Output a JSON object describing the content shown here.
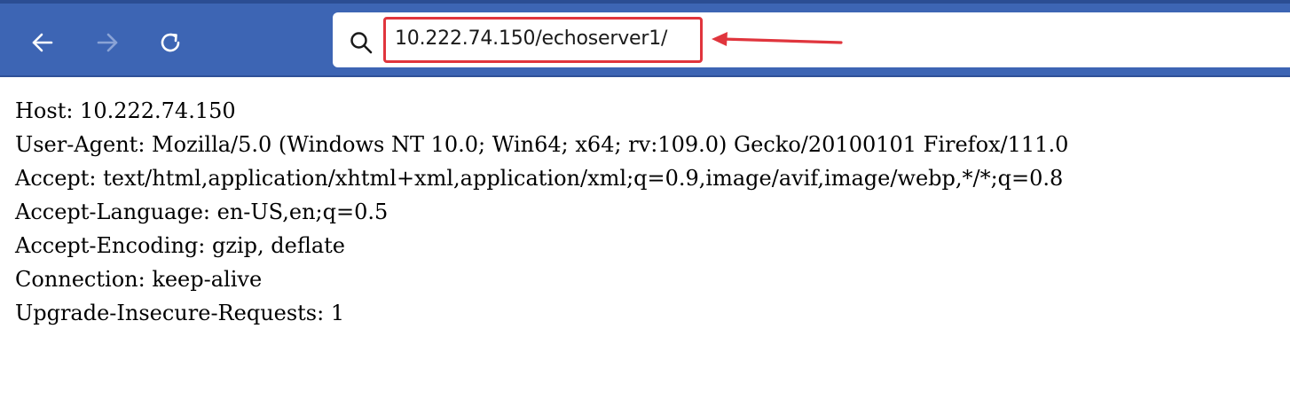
{
  "toolbar": {
    "back_icon": "back-arrow-icon",
    "forward_icon": "forward-arrow-icon",
    "reload_icon": "reload-icon",
    "search_icon": "search-icon",
    "url": "10.222.74.150/echoserver1/",
    "colors": {
      "toolbar_bg": "#3d65b4",
      "annotation": "#e0353d"
    }
  },
  "page": {
    "lines": [
      "Host: 10.222.74.150",
      "User-Agent: Mozilla/5.0 (Windows NT 10.0; Win64; x64; rv:109.0) Gecko/20100101 Firefox/111.0",
      "Accept: text/html,application/xhtml+xml,application/xml;q=0.9,image/avif,image/webp,*/*;q=0.8",
      "Accept-Language: en-US,en;q=0.5",
      "Accept-Encoding: gzip, deflate",
      "Connection: keep-alive",
      "Upgrade-Insecure-Requests: 1"
    ]
  }
}
